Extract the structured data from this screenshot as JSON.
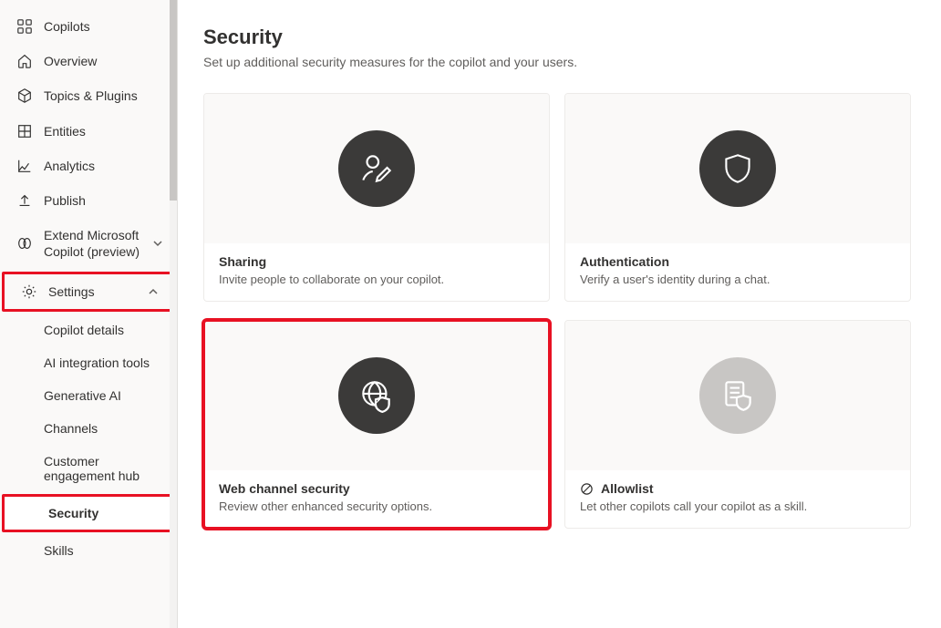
{
  "sidebar": {
    "copilots_label": "Copilots",
    "overview_label": "Overview",
    "topics_label": "Topics & Plugins",
    "entities_label": "Entities",
    "analytics_label": "Analytics",
    "publish_label": "Publish",
    "extend_label": "Extend Microsoft Copilot (preview)",
    "settings_label": "Settings",
    "settings_children": {
      "copilot_details": "Copilot details",
      "ai_integration": "AI integration tools",
      "generative_ai": "Generative AI",
      "channels": "Channels",
      "customer_hub": "Customer engagement hub",
      "security": "Security",
      "skills": "Skills"
    }
  },
  "page": {
    "title": "Security",
    "subtitle": "Set up additional security measures for the copilot and your users."
  },
  "cards": {
    "sharing": {
      "title": "Sharing",
      "desc": "Invite people to collaborate on your copilot."
    },
    "authentication": {
      "title": "Authentication",
      "desc": "Verify a user's identity during a chat."
    },
    "web_channel": {
      "title": "Web channel security",
      "desc": "Review other enhanced security options."
    },
    "allowlist": {
      "title": "Allowlist",
      "desc": "Let other copilots call your copilot as a skill."
    }
  }
}
